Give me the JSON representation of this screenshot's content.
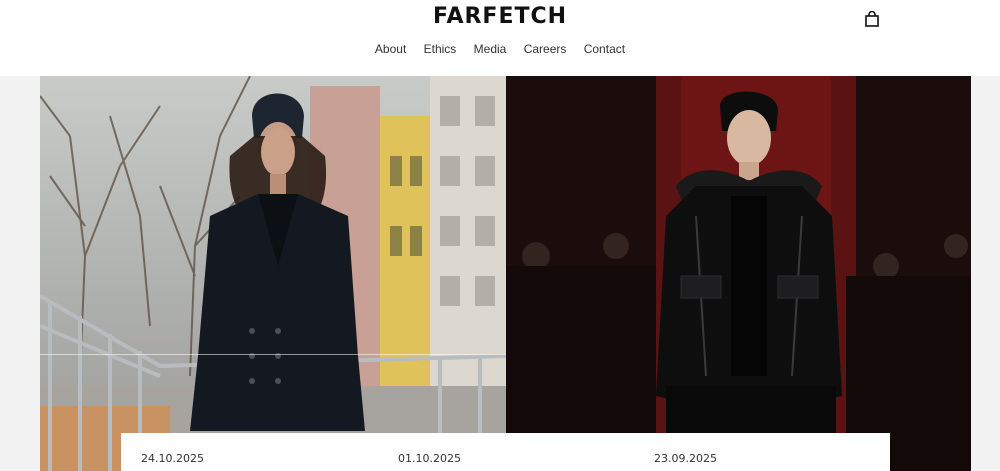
{
  "brand": {
    "name": "FARFETCH"
  },
  "nav": {
    "items": [
      {
        "label": "About"
      },
      {
        "label": "Ethics"
      },
      {
        "label": "Media"
      },
      {
        "label": "Careers"
      },
      {
        "label": "Contact"
      }
    ]
  },
  "header": {
    "cart_icon": "shopping-bag-icon"
  },
  "hero": {
    "left_image": "street-style-woman-black-coat-beanie",
    "right_image": "runway-model-black-leather-jacket-fur-collar"
  },
  "news": {
    "cards": [
      {
        "date": "24.10.2025"
      },
      {
        "date": "01.10.2025"
      },
      {
        "date": "23.09.2025"
      }
    ]
  }
}
